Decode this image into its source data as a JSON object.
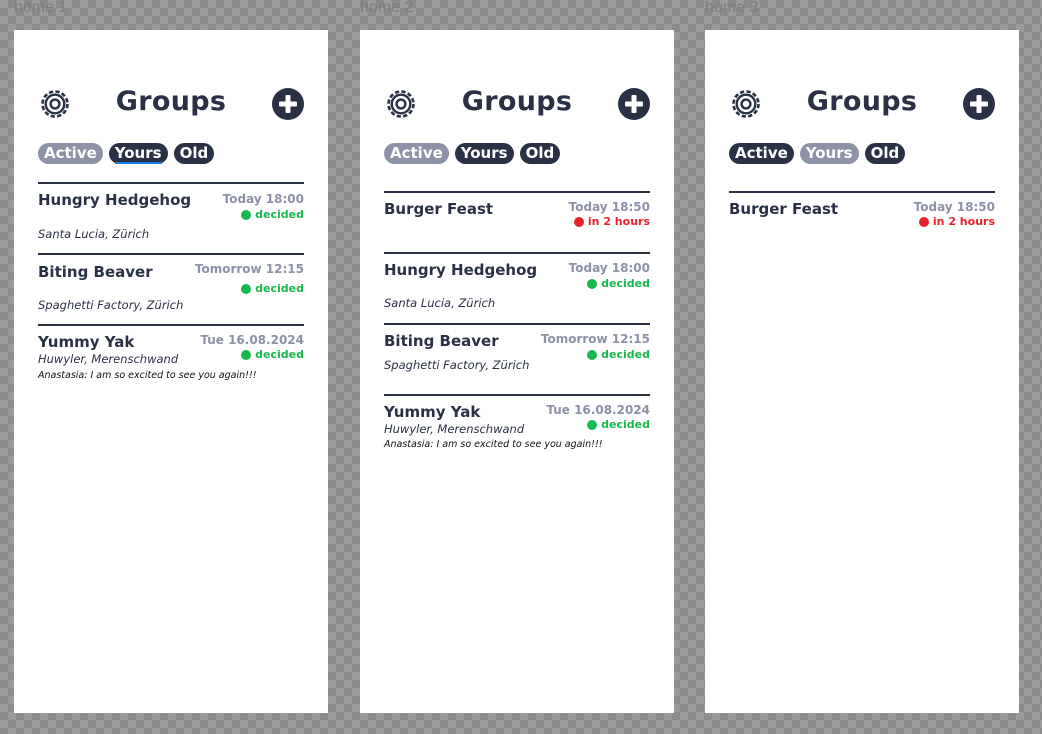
{
  "colors": {
    "navy": "#2a3145",
    "muted": "#8d92a6",
    "green": "#17b84d",
    "red": "#e8212f",
    "accent": "#1a7ce6"
  },
  "icons": {
    "settings": "gear-icon",
    "add": "plus-circle-icon"
  },
  "frames": [
    {
      "label": "home 1",
      "title": "Groups",
      "tabs": [
        {
          "label": "Active",
          "state": "inactive"
        },
        {
          "label": "Yours",
          "state": "selected-underlined"
        },
        {
          "label": "Old",
          "state": "active"
        }
      ],
      "items": [
        {
          "name": "Hungry Hedgehog",
          "time": "Today 18:00",
          "status": "decided",
          "location": "Santa Lucia, Zürich"
        },
        {
          "name": "Biting Beaver",
          "time": "Tomorrow 12:15",
          "status": "decided",
          "location": "Spaghetti Factory, Zürich"
        },
        {
          "name": "Yummy Yak",
          "time": "Tue 16.08.2024",
          "status": "decided",
          "location": "Huwyler, Merenschwand",
          "message": "Anastasia: I am so excited to see you again!!!"
        }
      ]
    },
    {
      "label": "home 2",
      "title": "Groups",
      "tabs": [
        {
          "label": "Active",
          "state": "inactive"
        },
        {
          "label": "Yours",
          "state": "active"
        },
        {
          "label": "Old",
          "state": "active"
        }
      ],
      "items": [
        {
          "name": "Burger Feast",
          "time": "Today 18:50",
          "status": "in 2 hours"
        },
        {
          "name": "Hungry Hedgehog",
          "time": "Today 18:00",
          "status": "decided",
          "location": "Santa Lucia, Zürich"
        },
        {
          "name": "Biting Beaver",
          "time": "Tomorrow 12:15",
          "status": "decided",
          "location": "Spaghetti Factory, Zürich"
        },
        {
          "name": "Yummy Yak",
          "time": "Tue 16.08.2024",
          "status": "decided",
          "location": "Huwyler, Merenschwand",
          "message": "Anastasia: I am so excited to see you again!!!"
        }
      ]
    },
    {
      "label": "home 3",
      "title": "Groups",
      "tabs": [
        {
          "label": "Active",
          "state": "active"
        },
        {
          "label": "Yours",
          "state": "inactive"
        },
        {
          "label": "Old",
          "state": "active"
        }
      ],
      "items": [
        {
          "name": "Burger Feast",
          "time": "Today 18:50",
          "status": "in 2 hours"
        }
      ]
    }
  ]
}
